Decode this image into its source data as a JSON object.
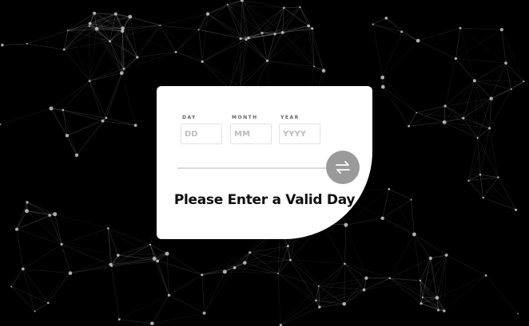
{
  "date_form": {
    "day": {
      "label": "DAY",
      "placeholder": "DD",
      "value": ""
    },
    "month": {
      "label": "MONTH",
      "placeholder": "MM",
      "value": ""
    },
    "year": {
      "label": "YEAR",
      "placeholder": "YYYY",
      "value": ""
    },
    "swap_icon": "swap-arrows-icon",
    "message": "Please Enter a Valid Day"
  },
  "colors": {
    "background": "#000000",
    "card": "#ffffff",
    "network_line": "#9a9a9a",
    "network_dot": "#c8c8c8",
    "swap_button": "#9a9a9a",
    "message_text": "#0f0f0f"
  }
}
